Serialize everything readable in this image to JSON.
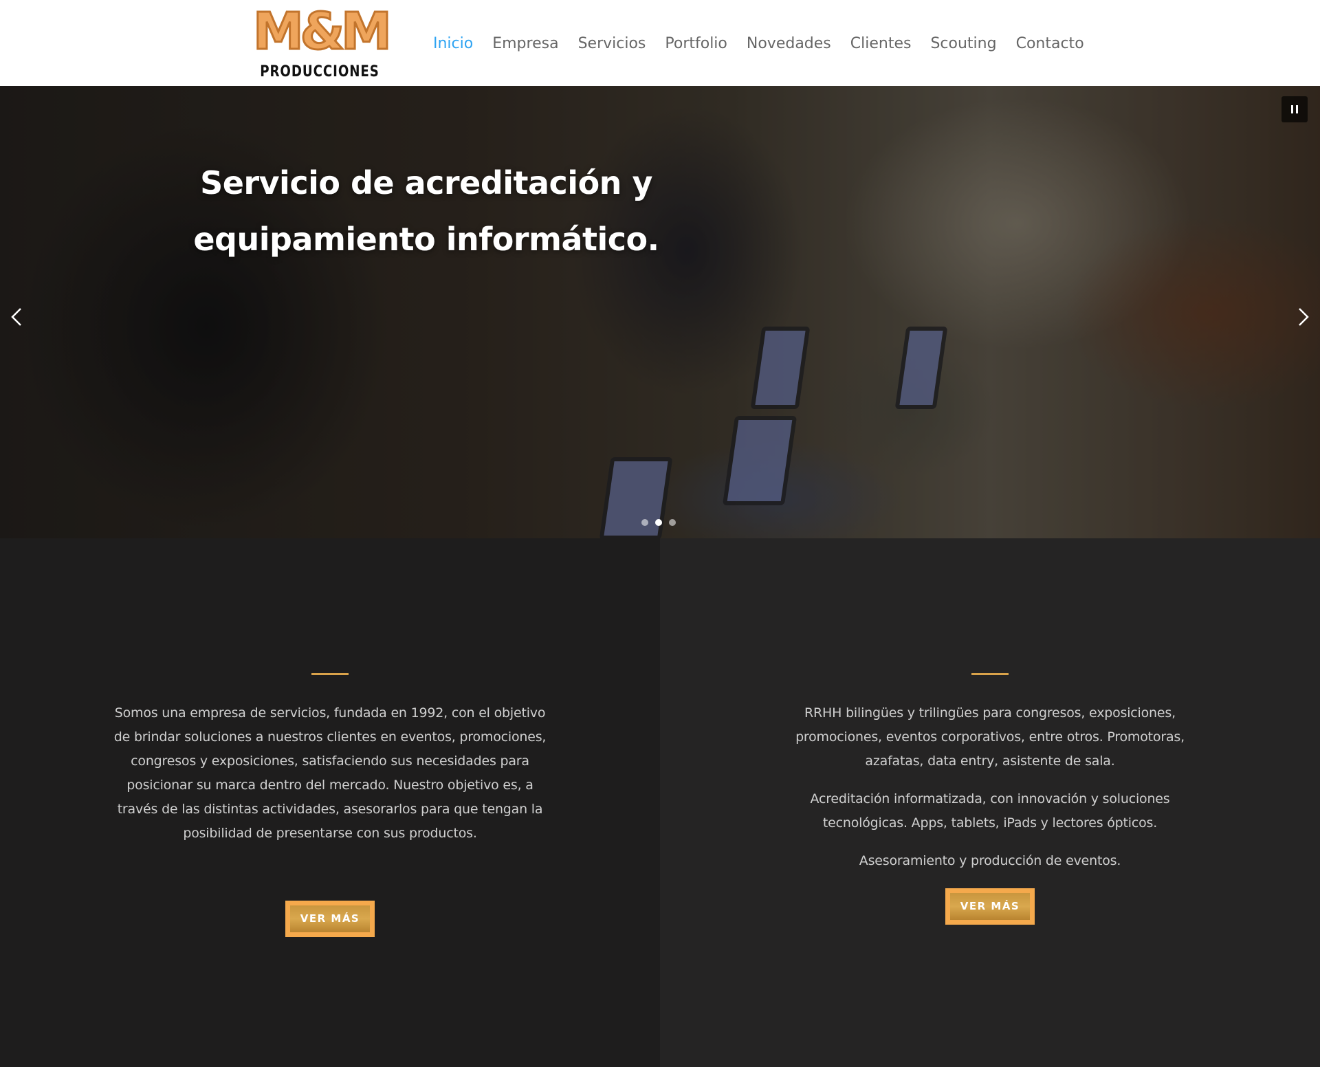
{
  "logo": {
    "brand": "M&M",
    "subtitle": "PRODUCCIONES"
  },
  "nav": {
    "items": [
      {
        "label": "Inicio",
        "active": true
      },
      {
        "label": "Empresa"
      },
      {
        "label": "Servicios"
      },
      {
        "label": "Portfolio"
      },
      {
        "label": "Novedades"
      },
      {
        "label": "Clientes"
      },
      {
        "label": "Scouting"
      },
      {
        "label": "Contacto"
      }
    ]
  },
  "hero": {
    "title_line1": "Servicio de acreditación y",
    "title_line2": "equipamiento informático.",
    "slides_total": 3,
    "active_slide": 2
  },
  "left_column": {
    "text": "Somos una empresa de servicios, fundada en 1992, con el objetivo de brindar soluciones a nuestros clientes en eventos, promociones, congresos y exposiciones, satisfaciendo sus necesidades para posicionar su marca dentro del mercado. Nuestro objetivo es, a través de las distintas actividades, asesorarlos para que tengan la posibilidad de presentarse con sus productos.",
    "button": "VER MÁS"
  },
  "right_column": {
    "paragraph1": "RRHH bilingües y trilingües para congresos, exposiciones, promociones, eventos corporativos, entre otros. Promotoras, azafatas, data entry, asistente de sala.",
    "paragraph2": "Acreditación informatizada, con innovación y soluciones tecnológicas. Apps, tablets, iPads y lectores ópticos.",
    "paragraph3": "Asesoramiento y producción de eventos.",
    "button": "VER MÁS"
  },
  "icons": {
    "prev": "chevron-left-icon",
    "next": "chevron-right-icon",
    "pause": "pause-icon"
  },
  "colors": {
    "accent_nav": "#2ea3f2",
    "accent_gold": "#d9a24a",
    "button_border": "#f5a94c",
    "logo_orange": "#efa55c"
  }
}
